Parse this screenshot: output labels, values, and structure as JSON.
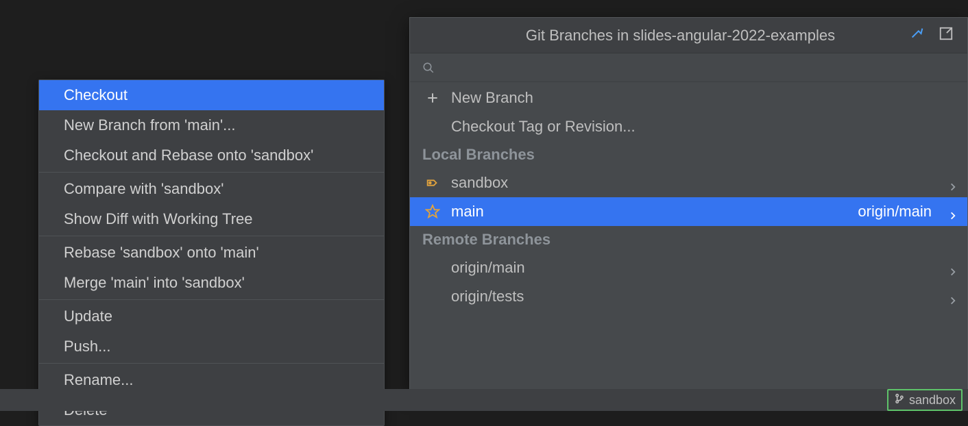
{
  "context_menu": {
    "groups": [
      [
        {
          "label": "Checkout",
          "selected": true
        },
        {
          "label": "New Branch from 'main'...",
          "selected": false
        },
        {
          "label": "Checkout and Rebase onto 'sandbox'",
          "selected": false
        }
      ],
      [
        {
          "label": "Compare with 'sandbox'",
          "selected": false
        },
        {
          "label": "Show Diff with Working Tree",
          "selected": false
        }
      ],
      [
        {
          "label": "Rebase 'sandbox' onto 'main'",
          "selected": false
        },
        {
          "label": "Merge 'main' into 'sandbox'",
          "selected": false
        }
      ],
      [
        {
          "label": "Update",
          "selected": false
        },
        {
          "label": "Push...",
          "selected": false
        }
      ],
      [
        {
          "label": "Rename...",
          "selected": false
        },
        {
          "label": "Delete",
          "selected": false
        }
      ]
    ]
  },
  "branches_popup": {
    "title": "Git Branches in slides-angular-2022-examples",
    "new_branch_label": "New Branch",
    "checkout_tag_label": "Checkout Tag or Revision...",
    "local_header": "Local Branches",
    "remote_header": "Remote Branches",
    "local_branches": [
      {
        "name": "sandbox",
        "icon": "bookmark",
        "tracking": "",
        "selected": false
      },
      {
        "name": "main",
        "icon": "star",
        "tracking": "origin/main",
        "selected": true
      }
    ],
    "remote_branches": [
      {
        "name": "origin/main"
      },
      {
        "name": "origin/tests"
      }
    ]
  },
  "status_bar": {
    "current_branch": "sandbox"
  }
}
